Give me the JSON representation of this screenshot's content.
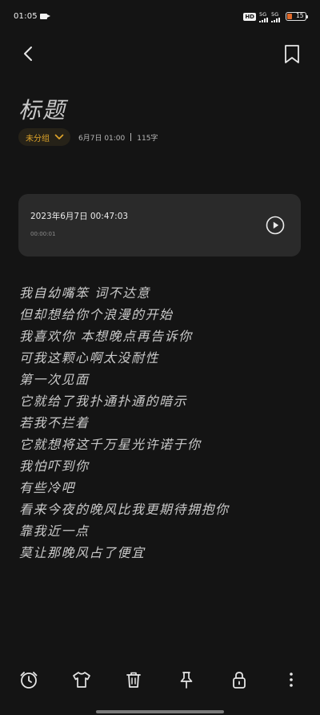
{
  "status_bar": {
    "time": "01:05",
    "hd_badge": "HD",
    "signal_1": "5G",
    "signal_2": "5G",
    "battery_level": "15",
    "battery_color": "#e06a2a"
  },
  "top_bar": {
    "back_icon": "chevron-left-icon",
    "bookmark_icon": "bookmark-icon"
  },
  "note": {
    "title": "标题",
    "category": "未分组",
    "date": "6月7日 01:00",
    "word_count": "115字",
    "accent_color": "#e0a52a"
  },
  "audio": {
    "datetime": "2023年6月7日 00:47:03",
    "duration": "00:00:01",
    "play_icon": "play-circle-icon"
  },
  "lyrics": [
    "我自幼嘴笨 词不达意",
    "但却想给你个浪漫的开始",
    "我喜欢你 本想晚点再告诉你",
    "可我这颗心啊太没耐性",
    "第一次见面",
    "它就给了我扑通扑通的暗示",
    "若我不拦着",
    "它就想将这千万星光许诺于你",
    "我怕吓到你",
    "有些冷吧",
    "看来今夜的晚风比我更期待拥抱你",
    "靠我近一点",
    "莫让那晚风占了便宜"
  ],
  "toolbar": {
    "icons": [
      "alarm-clock-icon",
      "tshirt-icon",
      "trash-icon",
      "pin-icon",
      "lock-icon",
      "more-vertical-icon"
    ]
  }
}
